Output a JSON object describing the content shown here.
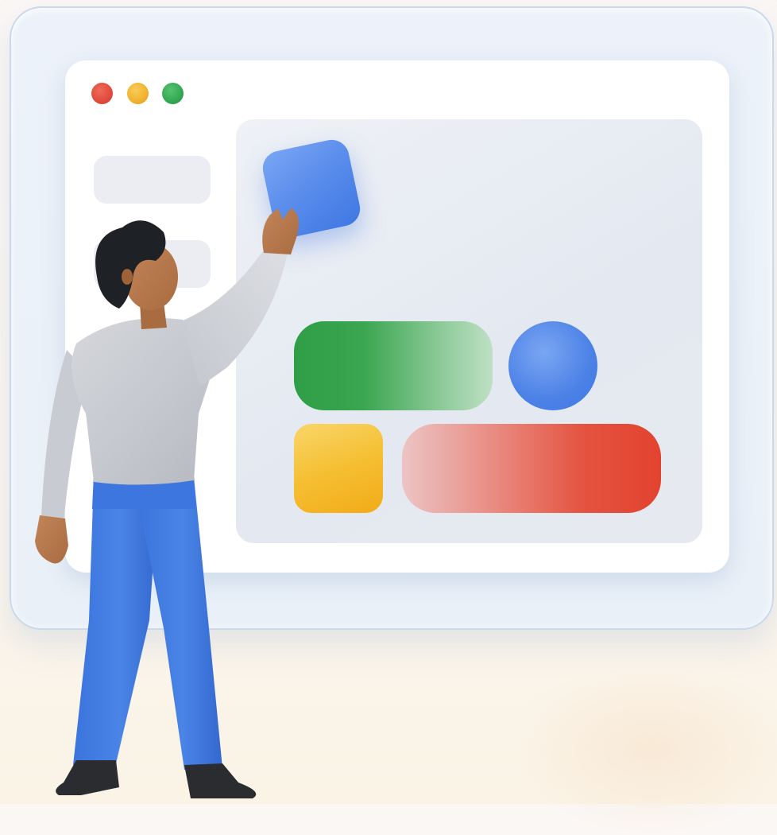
{
  "colors": {
    "background": "#fbf6ef",
    "frame_border": "#c9d9ec",
    "window": "#ffffff",
    "panel": "#e8ecf2",
    "sidebar_pill": "#ebedf2",
    "traffic_red": "#e04a3b",
    "traffic_yellow": "#f2b12c",
    "traffic_green": "#33a852",
    "block_blue_light": "#6b9cf1",
    "block_blue_dark": "#3f77e3",
    "block_green": "#2f9e46",
    "block_green_fade": "#bfe0c5",
    "block_yellow_light": "#f7cf55",
    "block_yellow_dark": "#f2ab18",
    "block_red": "#e2432f",
    "block_red_fade": "#ecc4c4",
    "shirt": "#c9ccd2",
    "pants": "#3a74dd",
    "hair": "#1e2226",
    "skin": "#b7784a",
    "shoes": "#2a2c30"
  },
  "illustration": {
    "window_controls": [
      "red-dot",
      "yellow-dot",
      "green-dot"
    ],
    "sidebar_placeholders": 2,
    "canvas_blocks": [
      "blue-rounded-square",
      "green-pill",
      "blue-circle",
      "yellow-rounded-square",
      "red-pill"
    ],
    "figure": "person-placing-block"
  }
}
